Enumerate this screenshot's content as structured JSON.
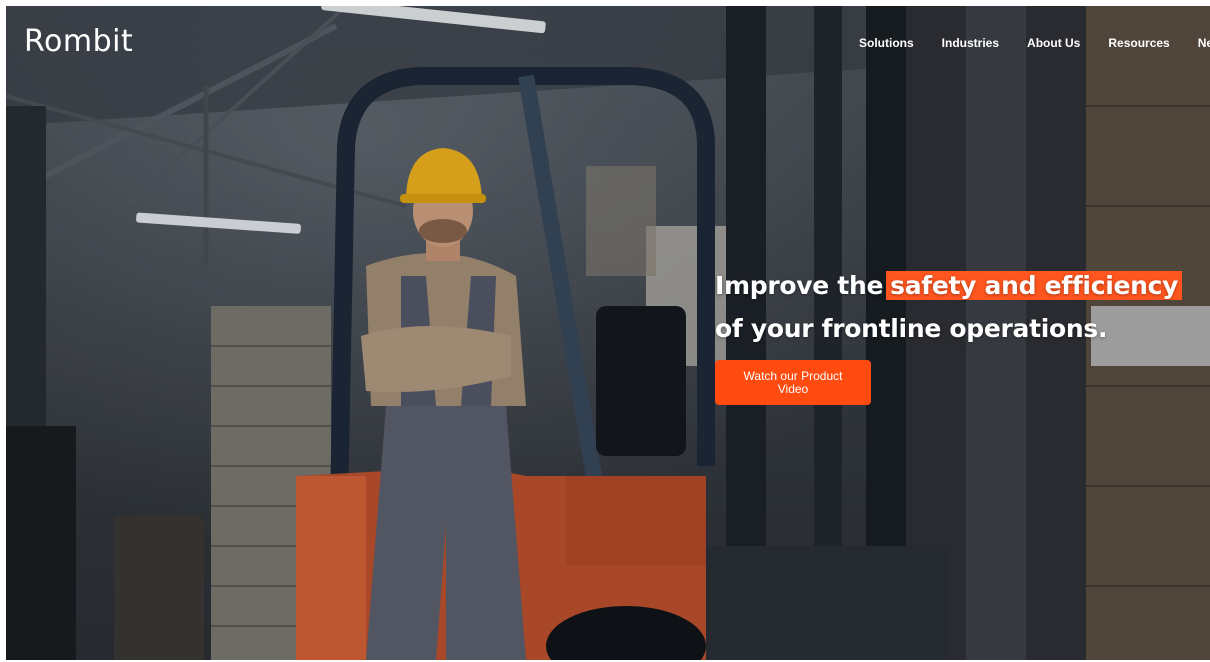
{
  "brand": {
    "logo_text": "Rombit",
    "accent_color": "#ff4a10"
  },
  "nav": {
    "items": [
      {
        "label": "Solutions"
      },
      {
        "label": "Industries"
      },
      {
        "label": "About Us"
      },
      {
        "label": "Resources"
      },
      {
        "label": "News"
      }
    ]
  },
  "hero": {
    "headline_prefix": "Improve the",
    "headline_highlight": "safety and efficiency",
    "headline_line2": "of your frontline operations.",
    "cta_label": "Watch our Product Video",
    "background_image": "warehouse-forklift-worker-photo"
  }
}
